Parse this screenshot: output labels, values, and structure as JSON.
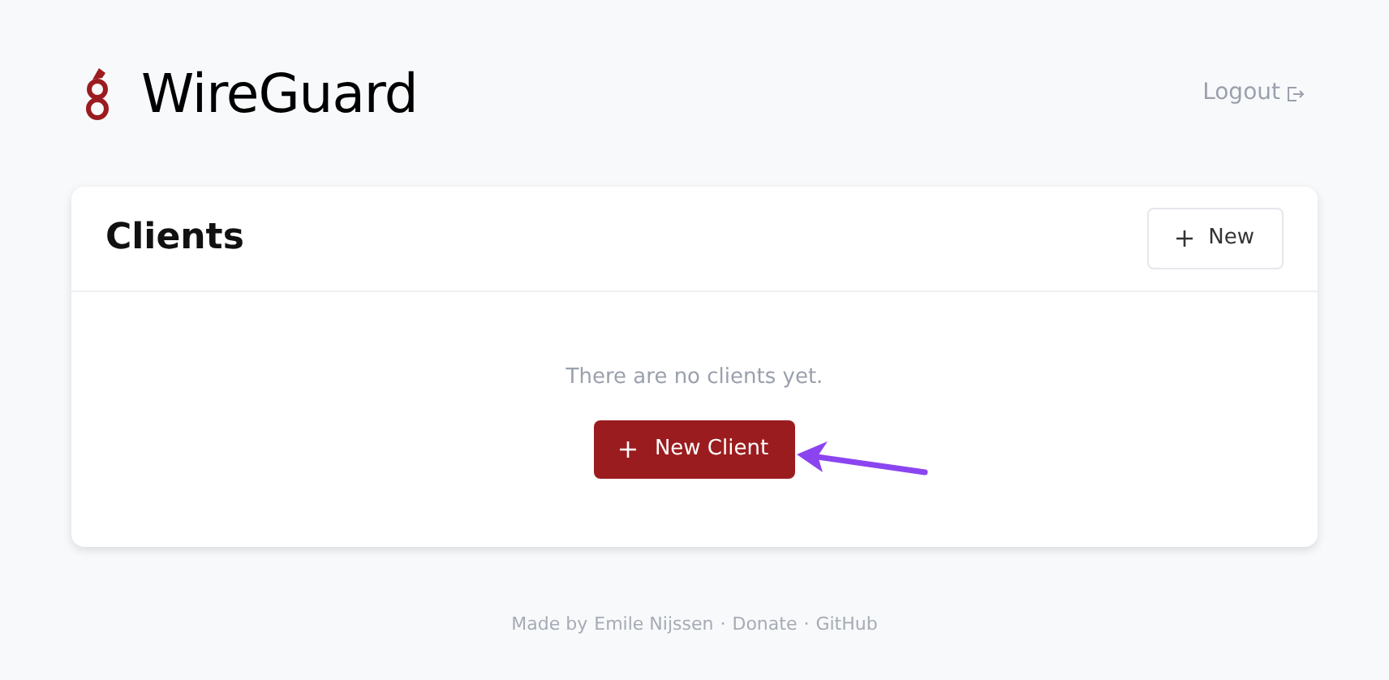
{
  "header": {
    "title": "WireGuard",
    "logout": "Logout"
  },
  "clients_panel": {
    "title": "Clients",
    "new_button": "New",
    "empty_message": "There are no clients yet.",
    "new_client_button": "New Client"
  },
  "footer": {
    "prefix": "Made by",
    "links": [
      "Emile Nijssen",
      "Donate",
      "GitHub"
    ],
    "separator": "·"
  }
}
